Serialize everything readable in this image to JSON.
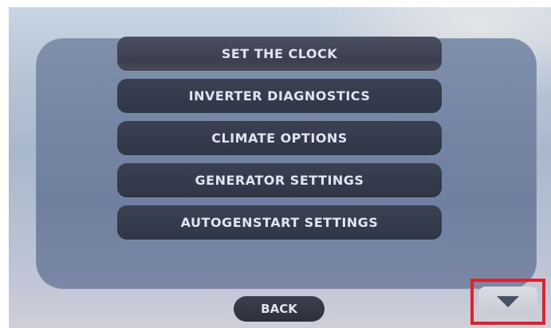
{
  "menu": {
    "items": [
      {
        "label": "SET THE CLOCK"
      },
      {
        "label": "INVERTER DIAGNOSTICS"
      },
      {
        "label": "CLIMATE OPTIONS"
      },
      {
        "label": "GENERATOR SETTINGS"
      },
      {
        "label": "AUTOGENSTART SETTINGS"
      }
    ]
  },
  "nav": {
    "back_label": "BACK",
    "scroll_icon": "triangle-down-icon"
  },
  "colors": {
    "panel": "#7486a3",
    "button": "#2f3646",
    "button_text": "#dfe6ef",
    "highlight": "#e0212b"
  }
}
